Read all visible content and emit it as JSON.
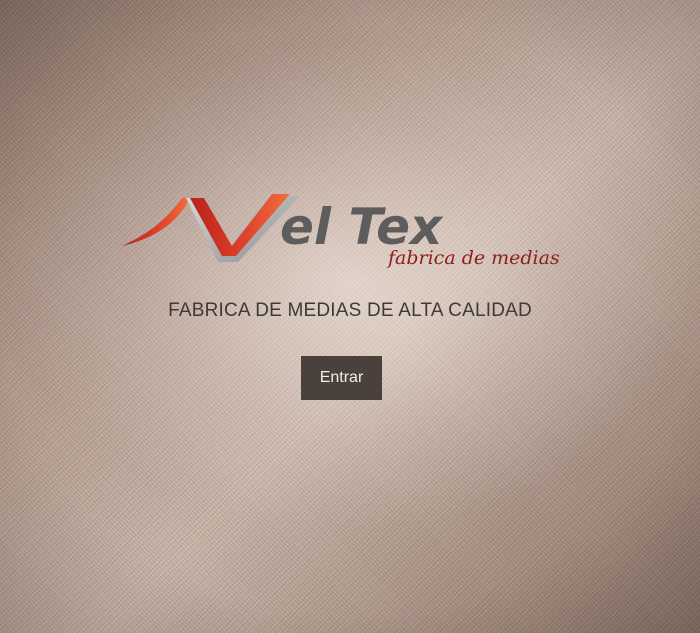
{
  "logo": {
    "brand_text": "el Tex",
    "subtitle": "fabrica de medias"
  },
  "tagline": "FABRICA DE MEDIAS DE ALTA CALIDAD",
  "enter_button": {
    "label": "Entrar"
  },
  "colors": {
    "logo_red": "#d9352a",
    "logo_grey": "#5d5d5d",
    "button_bg": "#4a413d",
    "subtitle_red": "#8e1e1e"
  }
}
